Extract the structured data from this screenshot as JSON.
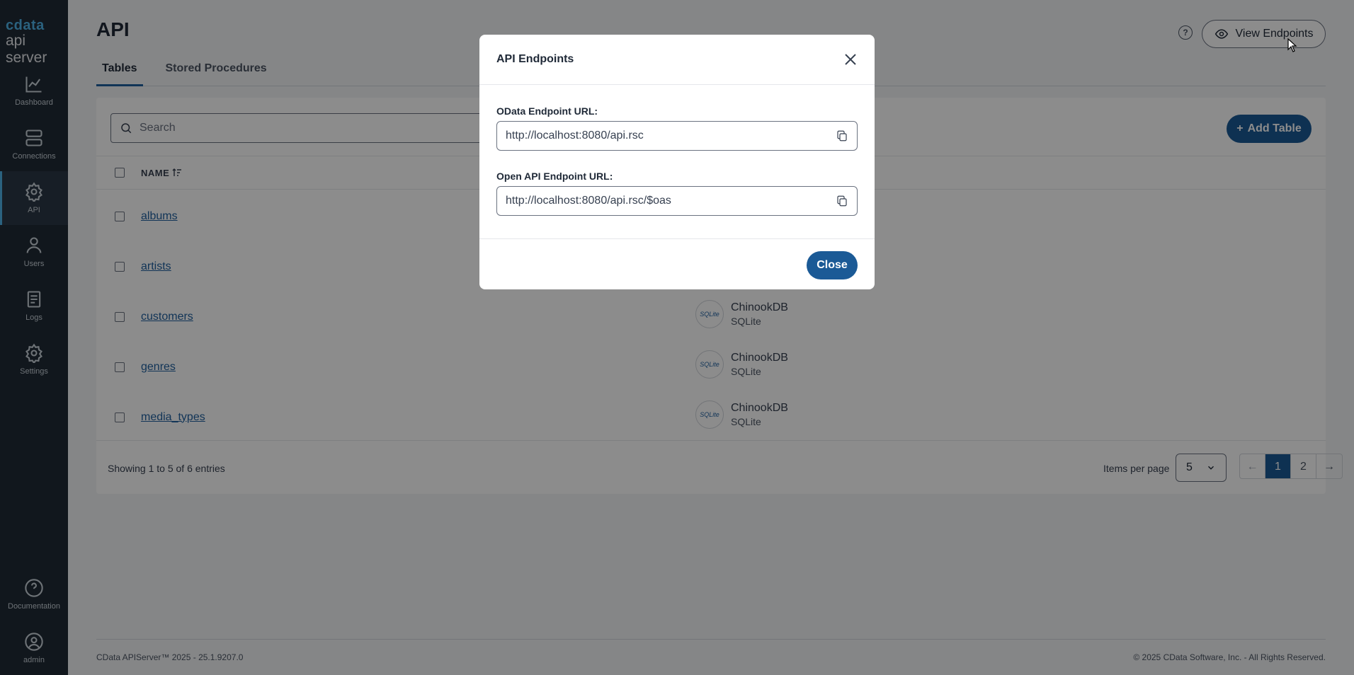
{
  "app": {
    "brand": "cdata",
    "product": "api server"
  },
  "sidebar": {
    "items": [
      {
        "label": "Dashboard",
        "icon": "chart-line-icon"
      },
      {
        "label": "Connections",
        "icon": "server-icon"
      },
      {
        "label": "API",
        "icon": "gear-icon",
        "active": true
      },
      {
        "label": "Users",
        "icon": "user-icon"
      },
      {
        "label": "Logs",
        "icon": "book-icon"
      },
      {
        "label": "Settings",
        "icon": "settings-icon"
      }
    ],
    "bottom": [
      {
        "label": "Documentation",
        "icon": "help-circle-icon"
      },
      {
        "label": "admin",
        "icon": "user-circle-icon"
      }
    ]
  },
  "header": {
    "title": "API",
    "help": "?",
    "view_endpoints": "View Endpoints"
  },
  "tabs": [
    {
      "label": "Tables",
      "active": true
    },
    {
      "label": "Stored Procedures",
      "active": false
    }
  ],
  "toolbar": {
    "search_placeholder": "Search",
    "add_table": "Add Table",
    "add_icon": "+"
  },
  "table": {
    "column_name": "NAME",
    "rows": [
      {
        "name": "albums"
      },
      {
        "name": "artists"
      },
      {
        "name": "customers",
        "connection": "ChinookDB",
        "type": "SQLite"
      },
      {
        "name": "genres",
        "connection": "ChinookDB",
        "type": "SQLite"
      },
      {
        "name": "media_types",
        "connection": "ChinookDB",
        "type": "SQLite"
      }
    ],
    "badge_text": "SQLite"
  },
  "pagination": {
    "entries": "Showing 1 to 5 of 6 entries",
    "items_per_page_label": "Items per page",
    "items_per_page": "5",
    "pages": [
      "1",
      "2"
    ],
    "prev": "←",
    "next": "→"
  },
  "footer": {
    "left": "CData APIServer™ 2025 - 25.1.9207.0",
    "right": "© 2025 CData Software, Inc. - All Rights Reserved."
  },
  "modal": {
    "title": "API Endpoints",
    "odata_label": "OData Endpoint URL:",
    "odata_value": "http://localhost:8080/api.rsc",
    "openapi_label": "Open API Endpoint URL:",
    "openapi_value": "http://localhost:8080/api.rsc/$oas",
    "close_label": "Close"
  },
  "colors": {
    "sidebar_bg": "#1f2b36",
    "accent": "#1b5a96",
    "link": "#1f5f9e"
  }
}
